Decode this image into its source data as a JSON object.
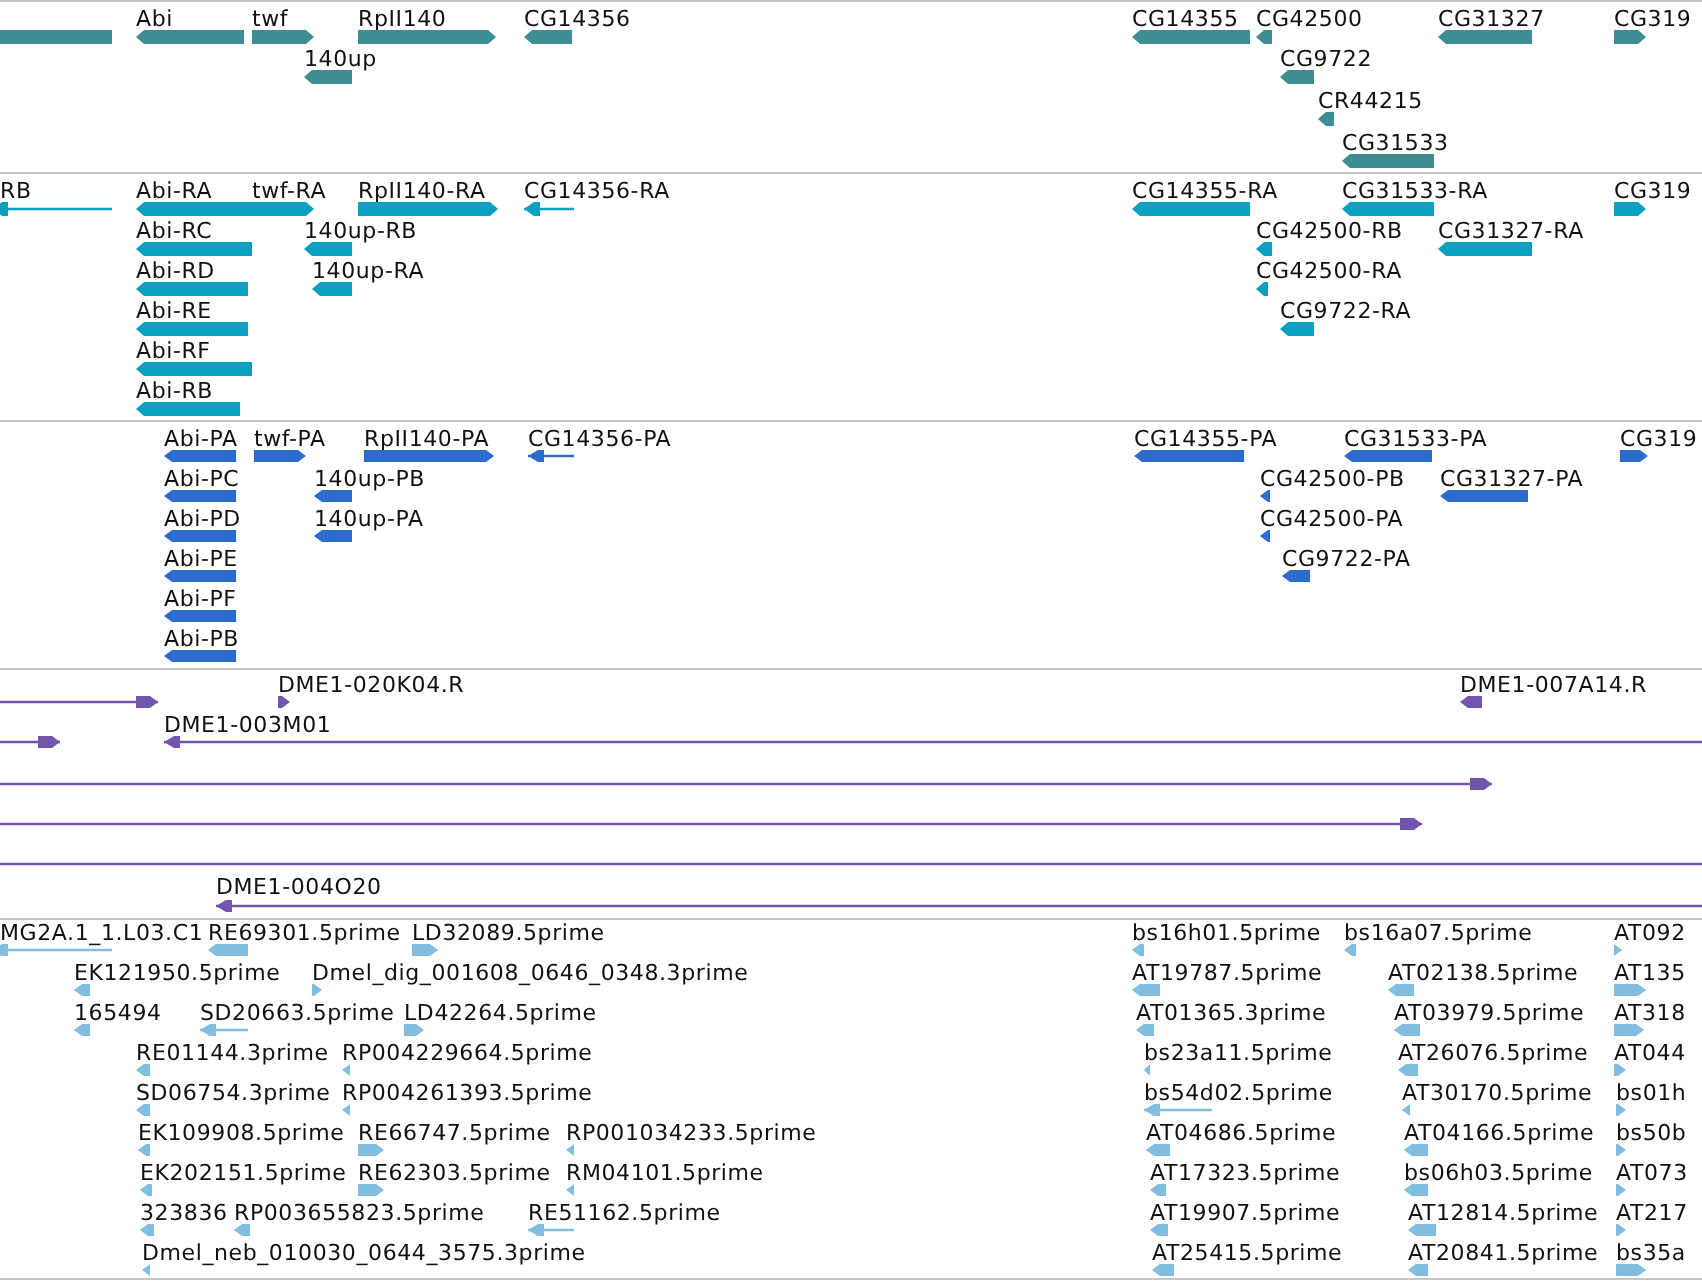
{
  "tracks": [
    {
      "color": "#3d8d93",
      "features": [
        {
          "reverse": true
        },
        {
          "label": "Abi",
          "reverse": true
        },
        {
          "label": "twf",
          "reverse": false
        },
        {
          "label": "RpII140",
          "reverse": false
        },
        {
          "label": "CG14356",
          "reverse": true
        },
        {
          "label": "CG14355",
          "reverse": true
        },
        {
          "label": "CG42500",
          "reverse": true
        },
        {
          "label": "CG31327",
          "reverse": true
        },
        {
          "label": "CG319",
          "reverse": false
        },
        {
          "label": "140up",
          "reverse": true
        },
        {
          "label": "CG9722",
          "reverse": true
        },
        {
          "label": "CR44215",
          "reverse": true
        },
        {
          "label": "CG31533",
          "reverse": true
        }
      ]
    },
    {
      "color": "#0aa0c0",
      "features": [
        {
          "label": "RB",
          "reverse": true
        },
        {
          "label": "Abi-RA",
          "reverse": true
        },
        {
          "label": "twf-RA",
          "reverse": false
        },
        {
          "label": "RpII140-RA",
          "reverse": false
        },
        {
          "label": "CG14356-RA",
          "reverse": true
        },
        {
          "label": "CG14355-RA",
          "reverse": true
        },
        {
          "label": "CG31533-RA",
          "reverse": true
        },
        {
          "label": "CG319",
          "reverse": false
        },
        {
          "label": "Abi-RC",
          "reverse": true
        },
        {
          "label": "140up-RB",
          "reverse": true
        },
        {
          "label": "CG42500-RB",
          "reverse": true
        },
        {
          "label": "CG31327-RA",
          "reverse": true
        },
        {
          "label": "Abi-RD",
          "reverse": true
        },
        {
          "label": "140up-RA",
          "reverse": true
        },
        {
          "label": "CG42500-RA",
          "reverse": true
        },
        {
          "label": "Abi-RE",
          "reverse": true
        },
        {
          "label": "CG9722-RA",
          "reverse": true
        },
        {
          "label": "Abi-RF",
          "reverse": true
        },
        {
          "label": "Abi-RB",
          "reverse": true
        }
      ]
    },
    {
      "color": "#2e6bcf",
      "features": [
        {
          "label": "Abi-PA",
          "reverse": true
        },
        {
          "label": "twf-PA",
          "reverse": false
        },
        {
          "label": "RpII140-PA",
          "reverse": false
        },
        {
          "label": "CG14356-PA",
          "reverse": true
        },
        {
          "label": "CG14355-PA",
          "reverse": true
        },
        {
          "label": "CG31533-PA",
          "reverse": true
        },
        {
          "label": "CG319",
          "reverse": false
        },
        {
          "label": "Abi-PC",
          "reverse": true
        },
        {
          "label": "140up-PB",
          "reverse": true
        },
        {
          "label": "CG42500-PB",
          "reverse": true
        },
        {
          "label": "CG31327-PA",
          "reverse": true
        },
        {
          "label": "Abi-PD",
          "reverse": true
        },
        {
          "label": "140up-PA",
          "reverse": true
        },
        {
          "label": "CG42500-PA",
          "reverse": true
        },
        {
          "label": "Abi-PE",
          "reverse": true
        },
        {
          "label": "CG9722-PA",
          "reverse": true
        },
        {
          "label": "Abi-PF",
          "reverse": true
        },
        {
          "label": "Abi-PB",
          "reverse": true
        }
      ]
    },
    {
      "color": "#7255ad",
      "features": [
        {
          "reverse": false
        },
        {
          "label": "DME1-020K04.R",
          "reverse": false
        },
        {
          "label": "DME1-007A14.R",
          "reverse": true
        },
        {
          "reverse": false
        },
        {
          "label": "DME1-003M01",
          "reverse": true
        },
        {
          "reverse": false
        },
        {
          "reverse": false
        },
        {
          "reverse": false
        },
        {
          "label": "DME1-004O20",
          "reverse": true
        }
      ]
    },
    {
      "color": "#80bde0",
      "features": [
        {
          "label": "MG2A.1_1.L03.C1",
          "reverse": true
        },
        {
          "label": "RE69301.5prime",
          "reverse": true
        },
        {
          "label": "LD32089.5prime",
          "reverse": false
        },
        {
          "label": "bs16h01.5prime",
          "reverse": true
        },
        {
          "label": "bs16a07.5prime",
          "reverse": true
        },
        {
          "label": "AT092",
          "reverse": false
        },
        {
          "label": "EK121950.5prime",
          "reverse": true
        },
        {
          "label": "Dmel_dig_001608_0646_0348.3prime",
          "reverse": false
        },
        {
          "label": "AT19787.5prime",
          "reverse": true
        },
        {
          "label": "AT02138.5prime",
          "reverse": true
        },
        {
          "label": "AT135",
          "reverse": false
        },
        {
          "label": "165494",
          "reverse": true
        },
        {
          "label": "SD20663.5prime",
          "reverse": true
        },
        {
          "label": "LD42264.5prime",
          "reverse": false
        },
        {
          "label": "AT01365.3prime",
          "reverse": true
        },
        {
          "label": "AT03979.5prime",
          "reverse": true
        },
        {
          "label": "AT318",
          "reverse": false
        },
        {
          "label": "RE01144.3prime",
          "reverse": true
        },
        {
          "label": "RP004229664.5prime",
          "reverse": true
        },
        {
          "label": "bs23a11.5prime",
          "reverse": true
        },
        {
          "label": "AT26076.5prime",
          "reverse": true
        },
        {
          "label": "AT044",
          "reverse": false
        },
        {
          "label": "SD06754.3prime",
          "reverse": true
        },
        {
          "label": "RP004261393.5prime",
          "reverse": true
        },
        {
          "label": "bs54d02.5prime",
          "reverse": true
        },
        {
          "label": "AT30170.5prime",
          "reverse": true
        },
        {
          "label": "bs01h",
          "reverse": false
        },
        {
          "label": "EK109908.5prime",
          "reverse": true
        },
        {
          "label": "RE66747.5prime",
          "reverse": false
        },
        {
          "label": "RP001034233.5prime",
          "reverse": true
        },
        {
          "label": "AT04686.5prime",
          "reverse": true
        },
        {
          "label": "AT04166.5prime",
          "reverse": true
        },
        {
          "label": "bs50b",
          "reverse": false
        },
        {
          "label": "EK202151.5prime",
          "reverse": true
        },
        {
          "label": "RE62303.5prime",
          "reverse": false
        },
        {
          "label": "RM04101.5prime",
          "reverse": true
        },
        {
          "label": "AT17323.5prime",
          "reverse": true
        },
        {
          "label": "bs06h03.5prime",
          "reverse": true
        },
        {
          "label": "AT073",
          "reverse": false
        },
        {
          "label": "323836",
          "reverse": true
        },
        {
          "label": "RP003655823.5prime",
          "reverse": true
        },
        {
          "label": "RE51162.5prime",
          "reverse": true
        },
        {
          "label": "AT19907.5prime",
          "reverse": true
        },
        {
          "label": "AT12814.5prime",
          "reverse": true
        },
        {
          "label": "AT217",
          "reverse": false
        },
        {
          "label": "Dmel_neb_010030_0644_3575.3prime",
          "reverse": true
        },
        {
          "label": "AT25415.5prime",
          "reverse": true
        },
        {
          "label": "AT20841.5prime",
          "reverse": true
        },
        {
          "label": "bs35a",
          "reverse": false
        }
      ]
    }
  ]
}
